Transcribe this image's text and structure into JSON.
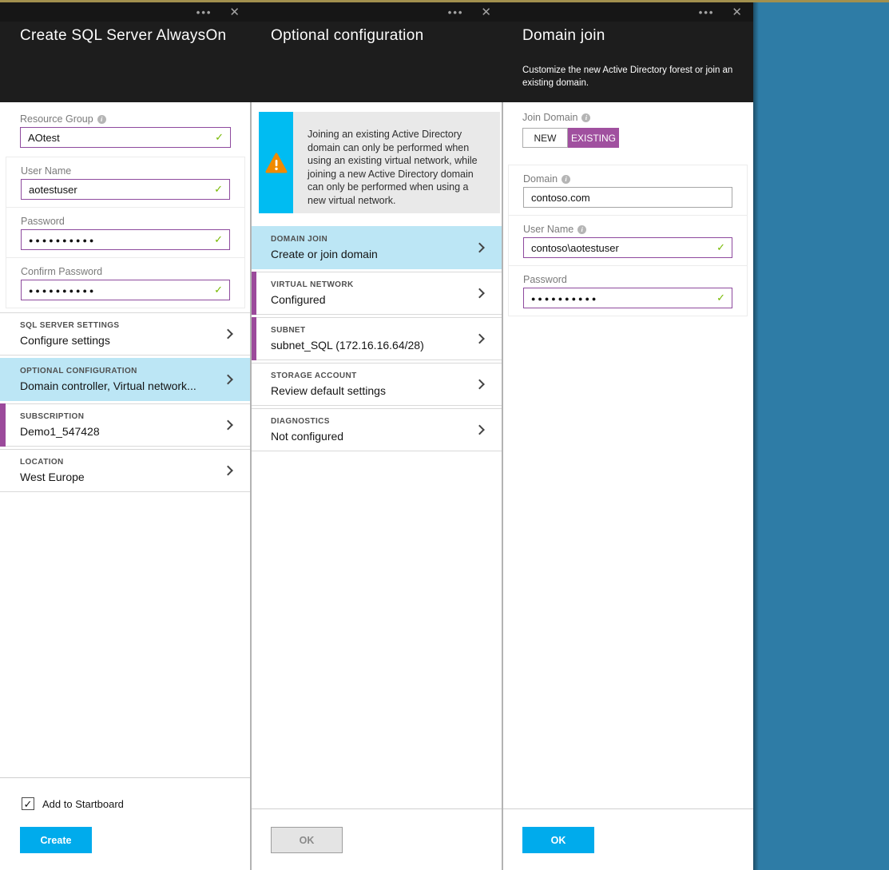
{
  "icons": {
    "more": "•••",
    "close": "✕",
    "check": "✓",
    "info": "i",
    "checkbox_check": "✓"
  },
  "colors": {
    "accent_blue": "#00abec",
    "selected_item_blue": "#bce6f5",
    "configured_purple": "#9b4a9b",
    "valid_border_purple": "#8e4a9e",
    "valid_check_green": "#76b900",
    "notice_cyan": "#00bcf2",
    "warning_orange": "#f08a00",
    "header_dark": "#1d1d1d",
    "desktop_teal": "#2e7ca6",
    "top_strip_gold": "#a2904e"
  },
  "blade1": {
    "title": "Create SQL Server AlwaysOn",
    "fields": [
      {
        "label": "Resource Group",
        "value": "AOtest"
      },
      {
        "label": "User Name",
        "value": "aotestuser"
      },
      {
        "label": "Password",
        "value": "●●●●●●●●●●"
      },
      {
        "label": "Confirm Password",
        "value": "●●●●●●●●●●"
      }
    ],
    "items": [
      {
        "label": "SQL SERVER SETTINGS",
        "value": "Configure settings"
      },
      {
        "label": "OPTIONAL CONFIGURATION",
        "value": "Domain controller, Virtual network..."
      },
      {
        "label": "SUBSCRIPTION",
        "value": "Demo1_547428"
      },
      {
        "label": "LOCATION",
        "value": "West Europe"
      }
    ],
    "startboard_label": "Add to Startboard",
    "create_label": "Create"
  },
  "blade2": {
    "title": "Optional configuration",
    "notice": "Joining an existing Active Directory domain can only be performed when using an existing virtual network, while joining a new Active Directory domain can only be performed when using a new virtual network.",
    "items": [
      {
        "label": "DOMAIN JOIN",
        "value": "Create or join domain"
      },
      {
        "label": "VIRTUAL NETWORK",
        "value": "Configured"
      },
      {
        "label": "SUBNET",
        "value": "subnet_SQL (172.16.16.64/28)"
      },
      {
        "label": "STORAGE ACCOUNT",
        "value": "Review default settings"
      },
      {
        "label": "DIAGNOSTICS",
        "value": "Not configured"
      }
    ],
    "ok_label": "OK"
  },
  "blade3": {
    "title": "Domain join",
    "subtitle": "Customize the new Active Directory forest or join an existing domain.",
    "join_domain": {
      "label": "Join Domain",
      "options": [
        "NEW",
        "EXISTING"
      ],
      "selected": "EXISTING"
    },
    "fields": [
      {
        "label": "Domain",
        "value": "contoso.com"
      },
      {
        "label": "User Name",
        "value": "contoso\\aotestuser"
      },
      {
        "label": "Password",
        "value": "●●●●●●●●●●"
      }
    ],
    "ok_label": "OK"
  }
}
